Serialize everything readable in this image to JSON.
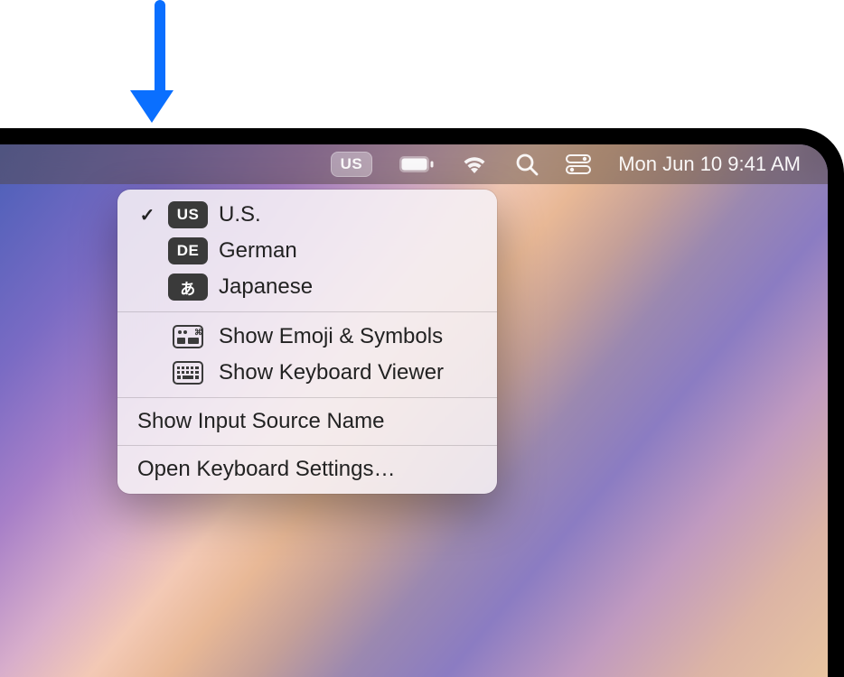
{
  "menubar": {
    "input_source_badge": "US",
    "clock": "Mon Jun 10  9:41 AM",
    "icons": [
      "battery-icon",
      "wifi-icon",
      "search-icon",
      "control-center-icon"
    ]
  },
  "dropdown": {
    "sources": [
      {
        "badge": "US",
        "label": "U.S.",
        "checked": true
      },
      {
        "badge": "DE",
        "label": "German",
        "checked": false
      },
      {
        "badge": "あ",
        "label": "Japanese",
        "checked": false
      }
    ],
    "actions": [
      {
        "icon": "emoji-symbols-icon",
        "label": "Show Emoji & Symbols"
      },
      {
        "icon": "keyboard-viewer-icon",
        "label": "Show Keyboard Viewer"
      }
    ],
    "toggle_label": "Show Input Source Name",
    "settings_label": "Open Keyboard Settings…"
  },
  "annotation": {
    "arrow_color": "#0a6fff"
  }
}
